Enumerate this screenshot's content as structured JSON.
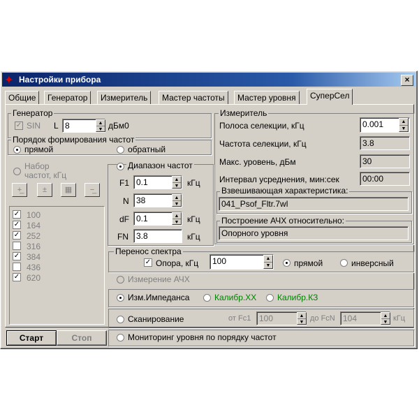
{
  "window": {
    "title": "Настройки прибора",
    "close": "×"
  },
  "tabs": [
    "Общие",
    "Генератор",
    "Измеритель",
    "Мастер частоты",
    "Мастер уровня",
    "СуперСел"
  ],
  "generator": {
    "label": "Генератор",
    "sin_label": "SIN",
    "sin_checked": true,
    "l_label": "L",
    "l_value": "8",
    "unit": "дБм0"
  },
  "order": {
    "label": "Порядок формирования частот",
    "direct": "прямой",
    "reverse": "обратный"
  },
  "freqset": {
    "label": "Набор частот, кГц",
    "values": [
      "100",
      "164",
      "252",
      "316",
      "384",
      "436",
      "620"
    ],
    "checked": [
      true,
      true,
      true,
      false,
      true,
      false,
      true
    ]
  },
  "range": {
    "label": "Диапазон частот",
    "f1_label": "F1",
    "f1_value": "0.1",
    "f1_unit": "кГц",
    "n_label": "N",
    "n_value": "38",
    "df_label": "dF",
    "df_value": "0.1",
    "df_unit": "кГц",
    "fn_label": "FN",
    "fn_value": "3.8",
    "fn_unit": "кГц"
  },
  "meter": {
    "label": "Измеритель",
    "bw_label": "Полоса селекции, кГц",
    "bw_value": "0.001",
    "freq_label": "Частота селекции, кГц",
    "freq_value": "3.8",
    "max_label": "Макс. уровень, дБм",
    "max_value": "30",
    "interval_label": "Интервал усреднения, мин:сек",
    "interval_value": "00:00",
    "weight_label": "Взвешивающая характеристика:",
    "weight_value": "041_Psof_Fltr.7wl",
    "afc_label": "Построение АЧХ относительно:",
    "afc_value": "Опорного уровня"
  },
  "transfer": {
    "label": "Перенос спектра",
    "ref_label": "Опора, кГц",
    "ref_checked": true,
    "ref_value": "100",
    "direct": "прямой",
    "inverse": "инверсный"
  },
  "modes": {
    "afc": "Измерение АЧХ",
    "impedance": "Изм.Импеданса",
    "calib_xx": "Калибр.ХХ",
    "calib_kz": "Калибр.КЗ",
    "scan": "Сканирование",
    "from_label": "от Fc1",
    "from_value": "100",
    "to_label": "до FcN",
    "to_value": "104",
    "scan_unit": "кГц",
    "monitor": "Мониторинг  уровня по порядку частот"
  },
  "buttons": {
    "start": "Старт",
    "stop": "Стоп"
  },
  "toolbar_icons": [
    "add-freq-icon",
    "insert-freq-icon",
    "load-freq-icon",
    "remove-freq-icon"
  ]
}
